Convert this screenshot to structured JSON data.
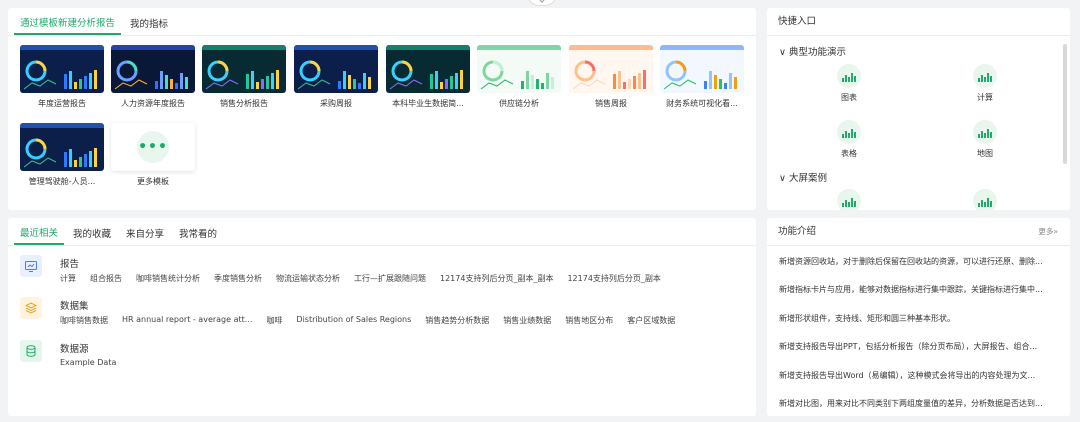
{
  "templates": {
    "tabs": [
      {
        "label": "通过模板新建分析报告",
        "active": true
      },
      {
        "label": "我的指标",
        "active": false
      }
    ],
    "items": [
      {
        "label": "年度运营报告",
        "theme": "dark-blue"
      },
      {
        "label": "人力资源年度报告",
        "theme": "dark-navy"
      },
      {
        "label": "销售分析报告",
        "theme": "dark-teal"
      },
      {
        "label": "采购周报",
        "theme": "dark-blue"
      },
      {
        "label": "本科毕业生数据简...",
        "theme": "dark-teal"
      },
      {
        "label": "供应链分析",
        "theme": "light-green"
      },
      {
        "label": "销售周报",
        "theme": "light-orange"
      },
      {
        "label": "财务系统可视化看...",
        "theme": "light-blue"
      },
      {
        "label": "管理驾驶舱-人员...",
        "theme": "dark-blue"
      }
    ],
    "more_label": "更多模板",
    "more_glyph": "•••"
  },
  "recent": {
    "tabs": [
      {
        "label": "最近相关",
        "active": true
      },
      {
        "label": "我的收藏",
        "active": false
      },
      {
        "label": "来自分享",
        "active": false
      },
      {
        "label": "我常看的",
        "active": false
      }
    ],
    "sections": [
      {
        "title": "报告",
        "icon": "report-icon",
        "color": "#4a7cf0",
        "bg": "#e8efff",
        "items": [
          "计算",
          "组合报告",
          "咖啡销售统计分析",
          "季度销售分析",
          "物流运输状态分析",
          "工行—扩展跟随问题",
          "12174支持列后分页_副本_副本",
          "12174支持列后分页_副本"
        ]
      },
      {
        "title": "数据集",
        "icon": "layers-icon",
        "color": "#f0a020",
        "bg": "#fff4e0",
        "items": [
          "咖啡销售数据",
          "HR annual report - average att...",
          "咖啡",
          "Distribution of Sales Regions",
          "销售趋势分析数据",
          "销售业绩数据",
          "销售地区分布",
          "客户区域数据"
        ]
      },
      {
        "title": "数据源",
        "icon": "database-icon",
        "color": "#1faa6b",
        "bg": "#e5f6ec",
        "items": [
          "Example Data"
        ]
      }
    ]
  },
  "quick": {
    "title": "快捷入口",
    "groups": [
      {
        "label": "典型功能演示",
        "items": [
          "图表",
          "计算",
          "表格",
          "地图"
        ]
      },
      {
        "label": "大屏案例",
        "items": [
          "",
          ""
        ]
      }
    ],
    "chevron": "∨"
  },
  "features": {
    "title": "功能介绍",
    "more_label": "更多",
    "more_glyph": "»",
    "items": [
      "新增资源回收站，对于删除后保留在回收站的资源，可以进行还原、删除...",
      "新增指标卡片与应用，能够对数据指标进行集中跟踪，关键指标进行集中...",
      "新增形状组件，支持线、矩形和圆三种基本形状。",
      "新增支持报告导出PPT，包括分析报告（除分页布局），大屏报告、组合...",
      "新增支持报告导出Word（易编辑），这种模式会将导出的内容处理为文...",
      "新增对比图，用来对比不同类别下两组度量值的差异，分析数据是否达到..."
    ]
  },
  "colors": {
    "accent": "#1faa6b"
  }
}
